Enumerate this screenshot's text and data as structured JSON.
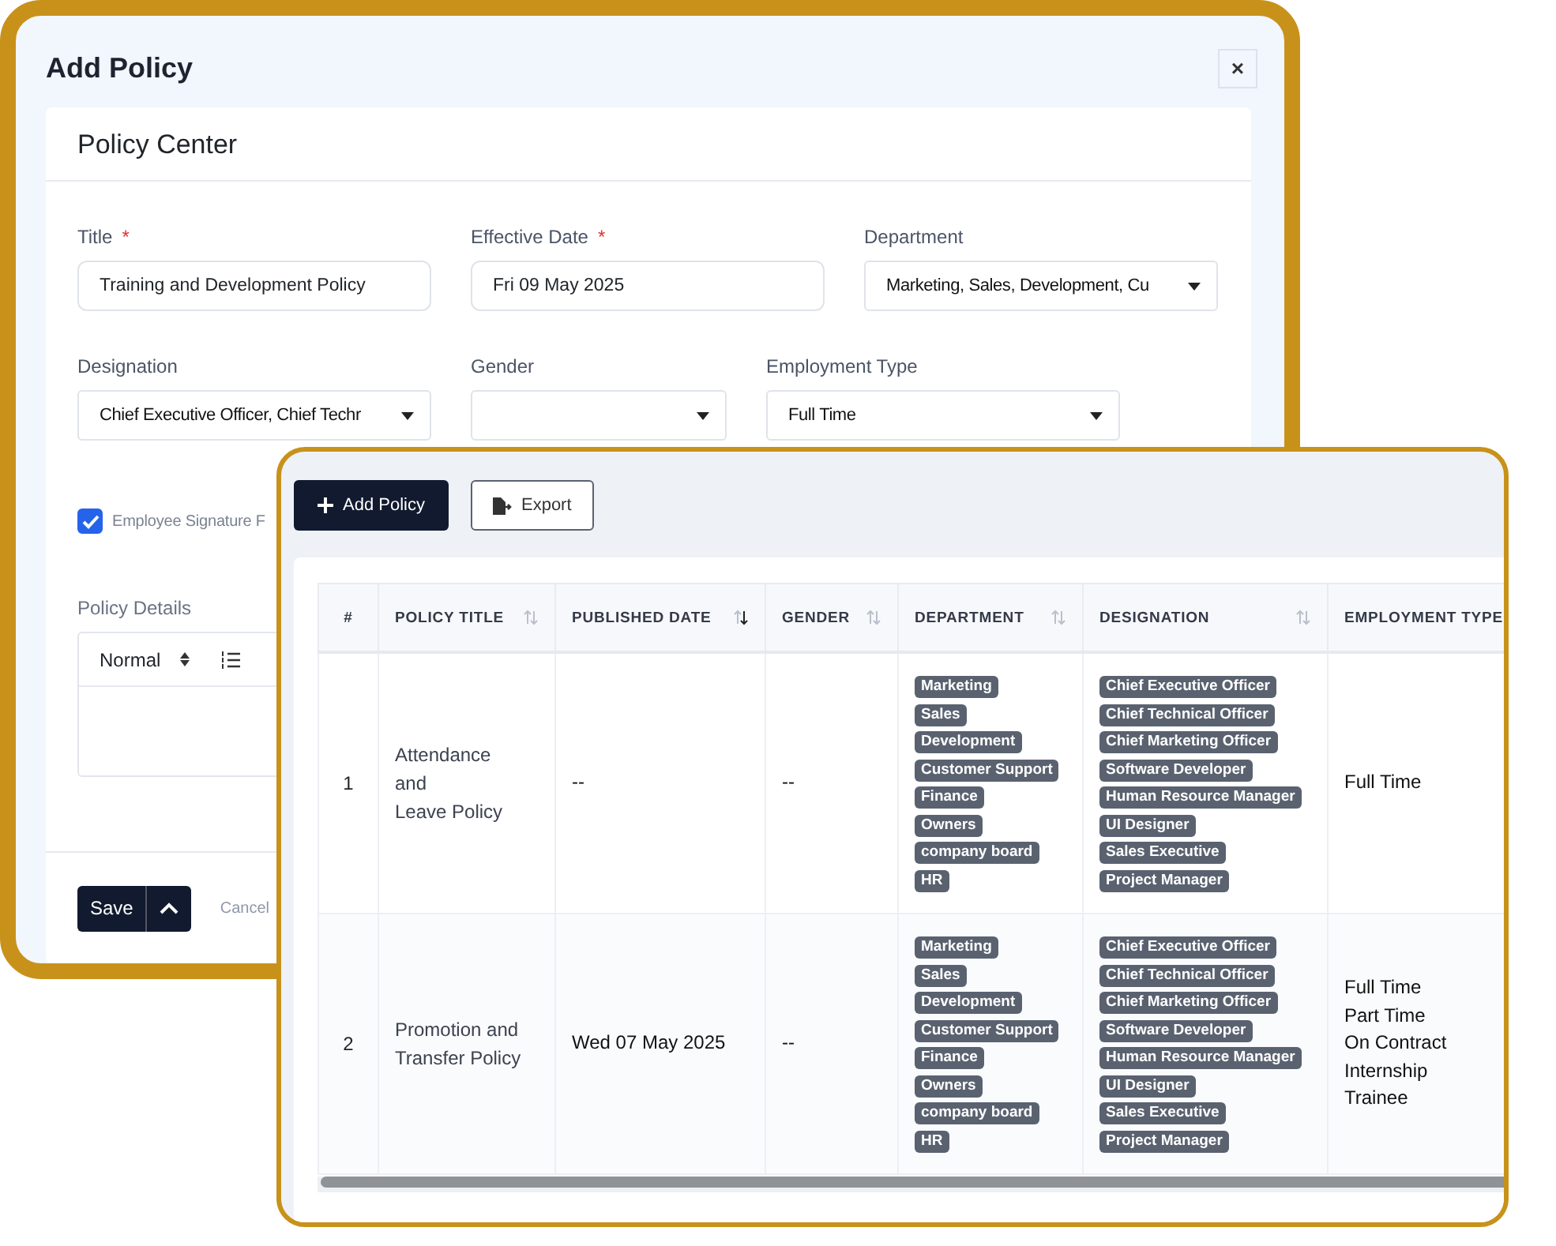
{
  "form": {
    "title": "Add Policy",
    "close": "×",
    "card_title": "Policy Center",
    "field_rows": [
      [
        {
          "label": "Title",
          "required_mark": "*",
          "kind": "text",
          "value": "Training and Development Policy"
        },
        {
          "label": "Effective Date",
          "required_mark": "*",
          "kind": "text",
          "value": "Fri 09 May 2025"
        },
        {
          "label": "Department",
          "kind": "select",
          "value": "Marketing, Sales, Development, Cu"
        }
      ],
      [
        {
          "label": "Designation",
          "kind": "select",
          "value": "Chief Executive Officer, Chief Techr"
        },
        {
          "label": "Gender",
          "kind": "select"
        },
        {
          "label": "Employment Type",
          "kind": "select",
          "value": "Full Time"
        }
      ]
    ],
    "checkbox": {
      "label": "Employee Signature F",
      "checked": true
    },
    "details": {
      "label": "Policy Details",
      "format": "Normal"
    },
    "save": "Save",
    "cancel": "Cancel"
  },
  "list": {
    "buttons": [
      {
        "label": "Add Policy",
        "kind": "primary"
      },
      {
        "label": "Export",
        "kind": "secondary"
      }
    ],
    "columns": [
      {
        "label": "#",
        "kind": "plain"
      },
      {
        "label": "POLICY TITLE",
        "kind": "sortable",
        "sorted": false
      },
      {
        "label": "PUBLISHED DATE",
        "kind": "sortable",
        "sorted": true
      },
      {
        "label": "GENDER",
        "kind": "sortable",
        "sorted": false
      },
      {
        "label": "DEPARTMENT",
        "kind": "sortable",
        "sorted": false
      },
      {
        "label": "DESIGNATION",
        "kind": "sortable",
        "sorted": false
      },
      {
        "label": "EMPLOYMENT TYPE",
        "kind": "plain"
      }
    ],
    "rows": [
      {
        "number": "1",
        "title": [
          "Attendance",
          "and",
          "Leave Policy"
        ],
        "published": "--",
        "gender": "--",
        "departments": [
          "Marketing",
          "Sales",
          "Development",
          "Customer Support",
          "Finance",
          "Owners",
          "company board",
          "HR"
        ],
        "designations": [
          "Chief Executive Officer",
          "Chief Technical Officer",
          "Chief Marketing Officer",
          "Software Developer",
          "Human Resource Manager",
          "UI Designer",
          "Sales Executive",
          "Project Manager"
        ],
        "employment_types": [
          "Full Time"
        ]
      },
      {
        "number": "2",
        "title": [
          "Promotion and",
          "Transfer Policy"
        ],
        "published": "Wed 07 May 2025",
        "gender": "--",
        "departments": [
          "Marketing",
          "Sales",
          "Development",
          "Customer Support",
          "Finance",
          "Owners",
          "company board",
          "HR"
        ],
        "designations": [
          "Chief Executive Officer",
          "Chief Technical Officer",
          "Chief Marketing Officer",
          "Software Developer",
          "Human Resource Manager",
          "UI Designer",
          "Sales Executive",
          "Project Manager"
        ],
        "employment_types": [
          "Full Time",
          "Part Time",
          "On Contract",
          "Internship",
          "Trainee"
        ]
      }
    ]
  }
}
